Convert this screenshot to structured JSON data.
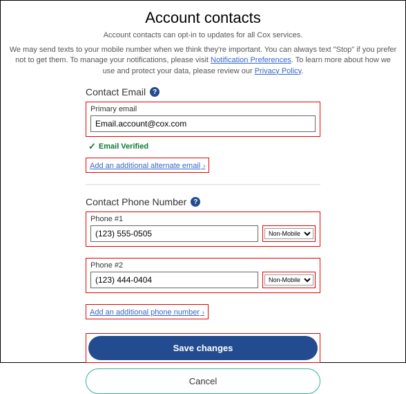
{
  "header": {
    "title": "Account contacts",
    "subtitle": "Account contacts can opt-in to updates for all Cox services.",
    "disclaimer_1": "We may send texts to your mobile number when we think they're important. You can always text \"Stop\" if you prefer not to get them. To manage your notifications, please visit ",
    "notif_link": "Notification Preferences",
    "disclaimer_2": ". To learn more about how we use and protect your data, please review our ",
    "privacy_link": "Privacy Policy",
    "disclaimer_3": "."
  },
  "email_section": {
    "heading": "Contact Email",
    "primary_label": "Primary email",
    "primary_value": "Email.account@cox.com",
    "verified_text": "Email Verified",
    "add_link": "Add an additional alternate email"
  },
  "phone_section": {
    "heading": "Contact Phone Number",
    "phones": [
      {
        "label": "Phone #1",
        "value": "(123) 555-0505",
        "type": "Non-Mobile"
      },
      {
        "label": "Phone #2",
        "value": "(123) 444-0404",
        "type": "Non-Mobile"
      }
    ],
    "add_link": "Add an additional phone number"
  },
  "buttons": {
    "save": "Save changes",
    "cancel": "Cancel"
  }
}
